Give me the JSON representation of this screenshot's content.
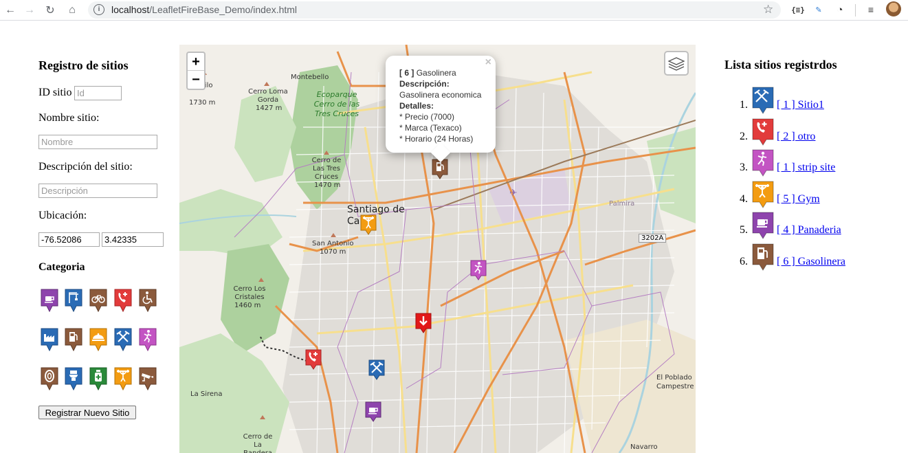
{
  "browser": {
    "url_host": "localhost",
    "url_path": "/LeafletFireBase_Demo/index.html"
  },
  "form": {
    "title": "Registro de sitios",
    "id_label": "ID sitio",
    "id_placeholder": "Id",
    "name_label": "Nombre sitio:",
    "name_placeholder": "Nombre",
    "desc_label": "Descripción del sitio:",
    "desc_placeholder": "Descripción",
    "location_label": "Ubicación:",
    "longitude": "-76.52086",
    "latitude": "3.42335",
    "category_label": "Categoria",
    "submit_label": "Registrar Nuevo Sitio",
    "categories": [
      {
        "name": "coffee",
        "color": "#8e44ad"
      },
      {
        "name": "construction",
        "color": "#2a6bb5"
      },
      {
        "name": "bicycle",
        "color": "#8b5a3c"
      },
      {
        "name": "emergency-phone",
        "color": "#e23b3b"
      },
      {
        "name": "accessibility",
        "color": "#8b5a3c"
      },
      {
        "name": "factory",
        "color": "#2a6bb5"
      },
      {
        "name": "gas-station",
        "color": "#8b5a3c"
      },
      {
        "name": "restaurant",
        "color": "#f39c12"
      },
      {
        "name": "mining",
        "color": "#2a6bb5"
      },
      {
        "name": "dance",
        "color": "#c354c3"
      },
      {
        "name": "tire",
        "color": "#8b5a3c"
      },
      {
        "name": "toilet",
        "color": "#2a6bb5"
      },
      {
        "name": "pharmacy",
        "color": "#2a8a3a"
      },
      {
        "name": "gym",
        "color": "#f39c12"
      },
      {
        "name": "camera",
        "color": "#8b5a3c"
      }
    ]
  },
  "popup": {
    "id": "[ 6 ]",
    "name": "Gasolinera",
    "desc_label": "Descripción:",
    "desc_value": "Gasolinera economica",
    "details_label": "Detalles:",
    "detail_1": "* Precio (7000)",
    "detail_2": "* Marca (Texaco)",
    "detail_3": "* Horario (24 Horas)"
  },
  "map_labels": {
    "city": "Santiago de Cali",
    "montebello": "Montebello",
    "cerro_loma": "Cerro Loma Gorda",
    "cerro_loma_alt": "1427 m",
    "ecoparque": "Ecoparque Cerro de las Tres Cruces",
    "tres_cruces": "Cerro de Las Tres Cruces",
    "tres_cruces_alt": "1470 m",
    "el_filo": "El Filo",
    "el_filo_alt": "1730 m",
    "san_antonio": "San Antonio",
    "san_antonio_alt": "1070 m",
    "cristales": "Cerro Los Cristales",
    "cristales_alt": "1460 m",
    "la_sirena": "La Sirena",
    "bandera": "Cerro de La Bandera",
    "el_poblado": "El Poblado Campestre",
    "navarro": "Navarro",
    "palmira": "Palmira",
    "route": "3202A"
  },
  "sites": {
    "title": "Lista sitios registrdos",
    "items": [
      {
        "num": "1.",
        "label": "[ 1 ] Sitio1",
        "color": "#2a6bb5",
        "icon": "mining-icon"
      },
      {
        "num": "2.",
        "label": "[ 2 ] otro",
        "color": "#e23b3b",
        "icon": "emergency-phone-icon"
      },
      {
        "num": "3.",
        "label": "[ 1 ] strip site",
        "color": "#c354c3",
        "icon": "dance-icon"
      },
      {
        "num": "4.",
        "label": "[ 5 ] Gym",
        "color": "#f39c12",
        "icon": "gym-icon"
      },
      {
        "num": "5.",
        "label": "[ 4 ] Panaderia",
        "color": "#8e44ad",
        "icon": "coffee-icon"
      },
      {
        "num": "6.",
        "label": "[ 6 ] Gasolinera",
        "color": "#8b5a3c",
        "icon": "gas-station-icon"
      }
    ]
  }
}
